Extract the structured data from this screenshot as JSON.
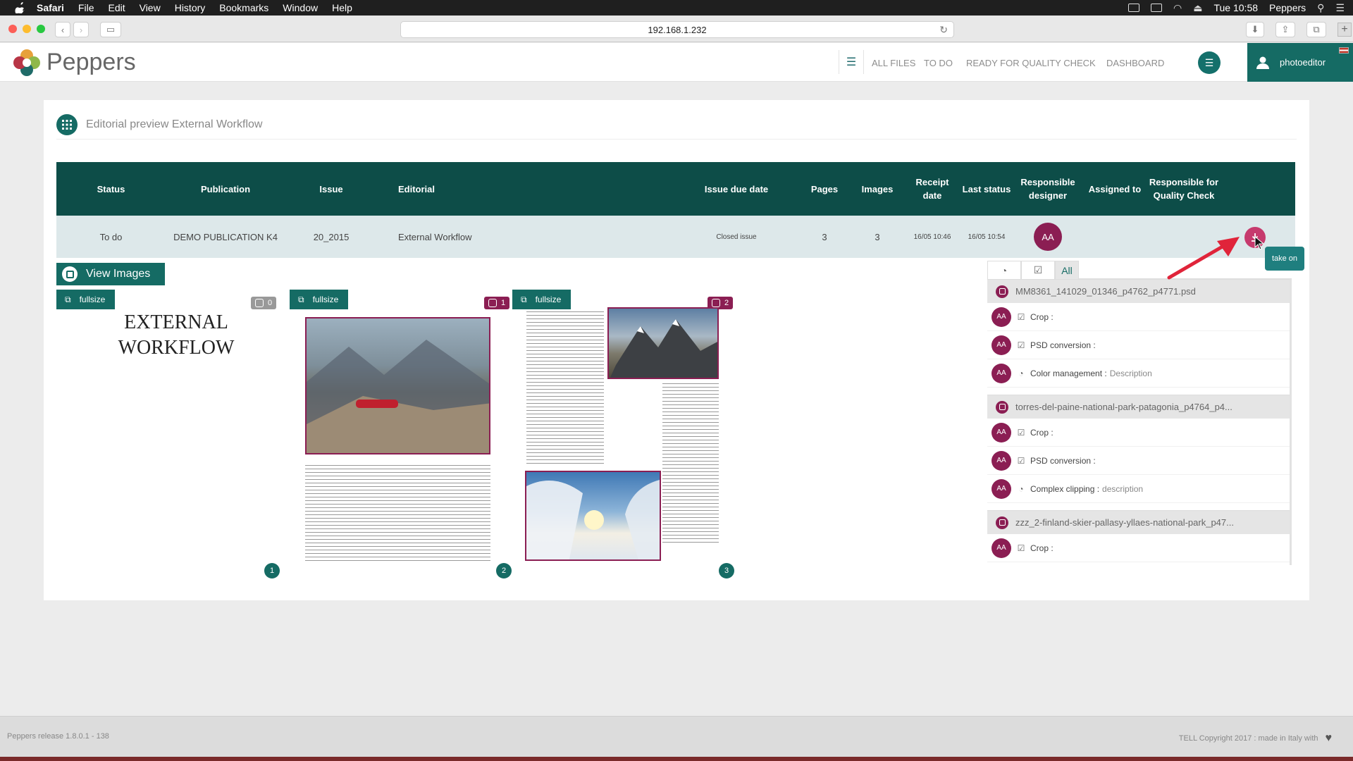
{
  "menubar": {
    "app": "Safari",
    "items": [
      "File",
      "Edit",
      "View",
      "History",
      "Bookmarks",
      "Window",
      "Help"
    ],
    "clock": "Tue 10:58",
    "user": "Peppers"
  },
  "browser": {
    "url": "192.168.1.232"
  },
  "header": {
    "brand": "Peppers",
    "nav": [
      "ALL FILES",
      "TO DO",
      "READY FOR QUALITY CHECK",
      "DASHBOARD"
    ],
    "username": "photoeditor"
  },
  "card": {
    "title": "Editorial preview External Workflow"
  },
  "table": {
    "columns": [
      "Status",
      "Publication",
      "Issue",
      "Editorial",
      "Issue due date",
      "Pages",
      "Images",
      "Receipt date",
      "Last status",
      "Responsible designer",
      "Assigned to",
      "Responsible for Quality Check"
    ],
    "row": {
      "status": "To do",
      "publication": "DEMO PUBLICATION K4",
      "issue": "20_2015",
      "editorial": "External Workflow",
      "due_date": "Closed issue",
      "pages": "3",
      "images": "3",
      "receipt_date": "16/05 10:46",
      "last_status": "16/05 10:54",
      "designer": "AA",
      "assigned_to": "",
      "quality": ""
    },
    "take_on_tooltip": "take on"
  },
  "preview": {
    "view_images_label": "View Images",
    "fullsize_label": "fullsize",
    "page1_title_line1": "EXTERNAL",
    "page1_title_line2": "WORKFLOW",
    "badges": [
      "0",
      "1",
      "2"
    ],
    "page_numbers": [
      "1",
      "2",
      "3"
    ]
  },
  "panel": {
    "tab_all": "All",
    "files": [
      {
        "name": "MM8361_141029_01346_p4762_p4771.psd",
        "tasks": [
          {
            "avatar": "AA",
            "icon": "check-square-icon",
            "label": "Crop :",
            "desc": ""
          },
          {
            "avatar": "AA",
            "icon": "check-square-icon",
            "label": "PSD conversion :",
            "desc": ""
          },
          {
            "avatar": "AA",
            "icon": "clock-icon",
            "label": "Color management :",
            "desc": "Description"
          }
        ]
      },
      {
        "name": "torres-del-paine-national-park-patagonia_p4764_p4...",
        "tasks": [
          {
            "avatar": "AA",
            "icon": "check-square-icon",
            "label": "Crop :",
            "desc": ""
          },
          {
            "avatar": "AA",
            "icon": "check-square-icon",
            "label": "PSD conversion :",
            "desc": ""
          },
          {
            "avatar": "AA",
            "icon": "clock-icon",
            "label": "Complex clipping :",
            "desc": "description"
          }
        ]
      },
      {
        "name": "zzz_2-finland-skier-pallasy-yllaes-national-park_p47...",
        "tasks": [
          {
            "avatar": "AA",
            "icon": "check-square-icon",
            "label": "Crop :",
            "desc": ""
          }
        ]
      }
    ]
  },
  "footer": {
    "release": "Peppers release 1.8.0.1 - 138",
    "copyright": "TELL Copyright 2017 : made in Italy with"
  },
  "colors": {
    "teal": "#156b64",
    "dark_teal": "#0d4d48",
    "magenta": "#8b1e53",
    "take_on": "#c63a6d"
  }
}
